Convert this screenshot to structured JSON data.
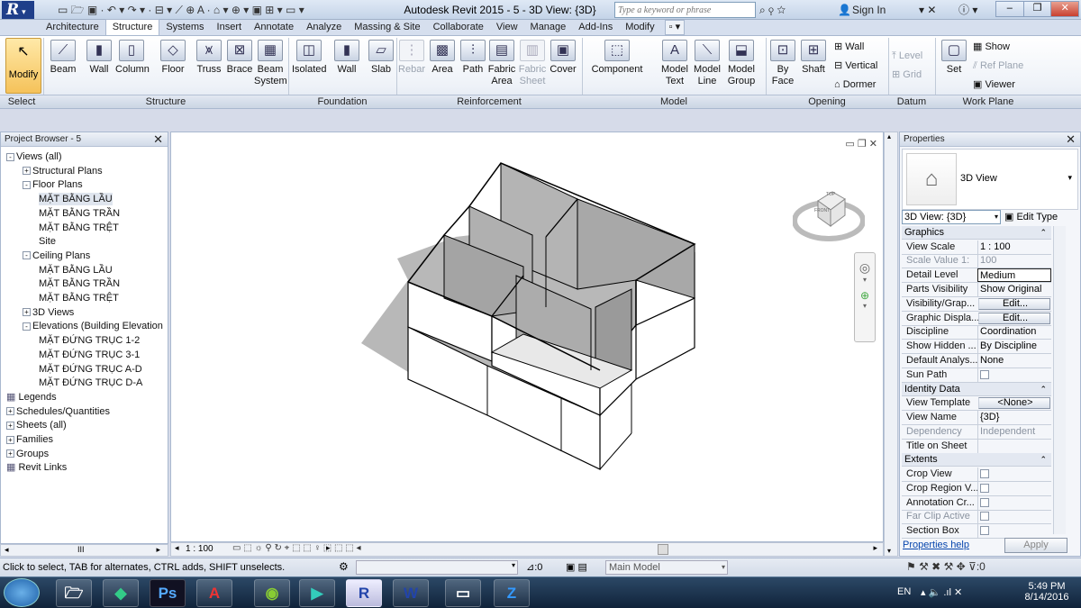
{
  "app": {
    "title": "Autodesk Revit 2015  -  5 - 3D View: {3D}",
    "search_placeholder": "Type a keyword or phrase",
    "sign_in": "Sign In",
    "logo": "R"
  },
  "tabs": [
    "Architecture",
    "Structure",
    "Systems",
    "Insert",
    "Annotate",
    "Analyze",
    "Massing & Site",
    "Collaborate",
    "View",
    "Manage",
    "Add-Ins",
    "Modify"
  ],
  "active_tab": "Structure",
  "ribbon": {
    "modify": "Modify",
    "select": "Select",
    "structure_buttons": [
      "Beam",
      "Wall",
      "Column",
      "Floor",
      "Truss",
      "Brace",
      "Beam System"
    ],
    "foundation_buttons": [
      "Isolated",
      "Wall",
      "Slab"
    ],
    "reinforcement_buttons": [
      "Rebar",
      "Area",
      "Path",
      "Fabric Area",
      "Fabric Sheet",
      "Cover"
    ],
    "model_buttons": [
      "Component",
      "Model Text",
      "Model Line",
      "Model Group"
    ],
    "opening_buttons": [
      "By Face",
      "Shaft",
      "Wall",
      "Vertical",
      "Dormer"
    ],
    "datum_buttons": [
      "Level",
      "Grid"
    ],
    "workplane_buttons": [
      "Set",
      "Show",
      "Ref Plane",
      "Viewer"
    ],
    "groups": [
      "Select",
      "Structure",
      "Foundation",
      "Reinforcement",
      "Model",
      "Opening",
      "Datum",
      "Work Plane"
    ]
  },
  "project_browser": {
    "title": "Project Browser - 5",
    "items": [
      {
        "label": "Views (all)",
        "level": 0,
        "exp": "-"
      },
      {
        "label": "Structural Plans",
        "level": 1,
        "exp": "+"
      },
      {
        "label": "Floor Plans",
        "level": 1,
        "exp": "-"
      },
      {
        "label": "MẶT BẰNG LẦU",
        "level": 2,
        "exp": ""
      },
      {
        "label": "MẶT BẰNG TRẦN",
        "level": 2,
        "exp": ""
      },
      {
        "label": "MẶT BẰNG TRỆT",
        "level": 2,
        "exp": ""
      },
      {
        "label": "Site",
        "level": 2,
        "exp": ""
      },
      {
        "label": "Ceiling Plans",
        "level": 1,
        "exp": "-"
      },
      {
        "label": "MẶT BẰNG LẦU",
        "level": 2,
        "exp": ""
      },
      {
        "label": "MẶT BẰNG TRẦN",
        "level": 2,
        "exp": ""
      },
      {
        "label": "MẶT BẰNG TRỆT",
        "level": 2,
        "exp": ""
      },
      {
        "label": "3D Views",
        "level": 1,
        "exp": "+"
      },
      {
        "label": "Elevations (Building Elevation",
        "level": 1,
        "exp": "-"
      },
      {
        "label": "MẶT ĐỨNG TRỤC 1-2",
        "level": 2,
        "exp": ""
      },
      {
        "label": "MẶT ĐỨNG TRỤC 3-1",
        "level": 2,
        "exp": ""
      },
      {
        "label": "MẶT ĐỨNG TRỤC A-D",
        "level": 2,
        "exp": ""
      },
      {
        "label": "MẶT ĐỨNG TRỤC D-A",
        "level": 2,
        "exp": ""
      },
      {
        "label": "Legends",
        "level": 0,
        "exp": ""
      },
      {
        "label": "Schedules/Quantities",
        "level": 0,
        "exp": "+"
      },
      {
        "label": "Sheets (all)",
        "level": 0,
        "exp": "+"
      },
      {
        "label": "Families",
        "level": 0,
        "exp": "+"
      },
      {
        "label": "Groups",
        "level": 0,
        "exp": "+"
      },
      {
        "label": "Revit Links",
        "level": 0,
        "exp": ""
      }
    ]
  },
  "view": {
    "scale": "1 : 100",
    "viewcube_top": "TOP",
    "viewcube_front": "FRONT"
  },
  "properties": {
    "title": "Properties",
    "type_name": "3D View",
    "type_select": "3D View: {3D}",
    "edit_type": "Edit Type",
    "sections": [
      {
        "name": "Graphics",
        "rows": [
          {
            "k": "View Scale",
            "v": "1 : 100",
            "dim": false,
            "kind": "text"
          },
          {
            "k": "Scale Value    1:",
            "v": "100",
            "dim": true,
            "kind": "text"
          },
          {
            "k": "Detail Level",
            "v": "Medium",
            "dim": false,
            "kind": "box"
          },
          {
            "k": "Parts Visibility",
            "v": "Show Original",
            "dim": false,
            "kind": "text"
          },
          {
            "k": "Visibility/Grap...",
            "v": "Edit...",
            "dim": false,
            "kind": "button"
          },
          {
            "k": "Graphic Displa...",
            "v": "Edit...",
            "dim": false,
            "kind": "button"
          },
          {
            "k": "Discipline",
            "v": "Coordination",
            "dim": false,
            "kind": "text"
          },
          {
            "k": "Show Hidden ...",
            "v": "By Discipline",
            "dim": false,
            "kind": "text"
          },
          {
            "k": "Default Analys...",
            "v": "None",
            "dim": false,
            "kind": "text"
          },
          {
            "k": "Sun Path",
            "v": "",
            "dim": false,
            "kind": "check"
          }
        ]
      },
      {
        "name": "Identity Data",
        "rows": [
          {
            "k": "View Template",
            "v": "<None>",
            "dim": false,
            "kind": "button"
          },
          {
            "k": "View Name",
            "v": "{3D}",
            "dim": false,
            "kind": "text"
          },
          {
            "k": "Dependency",
            "v": "Independent",
            "dim": true,
            "kind": "text"
          },
          {
            "k": "Title on Sheet",
            "v": "",
            "dim": false,
            "kind": "text"
          }
        ]
      },
      {
        "name": "Extents",
        "rows": [
          {
            "k": "Crop View",
            "v": "",
            "dim": false,
            "kind": "check"
          },
          {
            "k": "Crop Region V...",
            "v": "",
            "dim": false,
            "kind": "check"
          },
          {
            "k": "Annotation Cr...",
            "v": "",
            "dim": false,
            "kind": "check"
          },
          {
            "k": "Far Clip Active",
            "v": "",
            "dim": true,
            "kind": "check"
          },
          {
            "k": "Section Box",
            "v": "",
            "dim": false,
            "kind": "check"
          }
        ]
      }
    ],
    "help": "Properties help",
    "apply": "Apply"
  },
  "status": {
    "message": "Click to select, TAB for alternates, CTRL adds, SHIFT unselects.",
    "count": ":0",
    "model": "Main Model",
    "filter": ":0"
  },
  "taskbar": {
    "apps": [
      "start",
      "explorer",
      "sketchup",
      "photoshop",
      "autocad",
      "browser",
      "player",
      "revit",
      "word",
      "media",
      "zalo"
    ],
    "lang": "EN",
    "time": "5:49 PM",
    "date": "8/14/2016"
  }
}
